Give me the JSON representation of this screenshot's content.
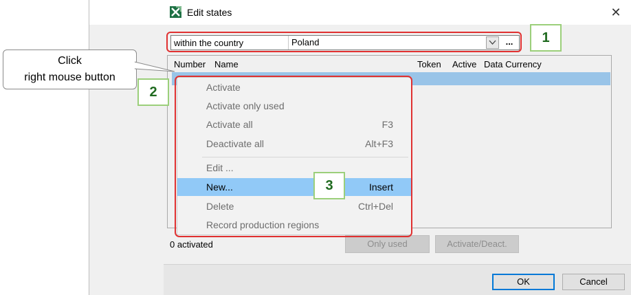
{
  "window": {
    "title": "Edit states",
    "close_glyph": "✕"
  },
  "filter": {
    "scope_label": "within the country",
    "country_value": "Poland",
    "ellipsis_label": "..."
  },
  "table": {
    "columns": [
      "Number",
      "Name",
      "Token",
      "Active",
      "Data Currency"
    ]
  },
  "context_menu": {
    "items": [
      {
        "label": "Activate",
        "shortcut": ""
      },
      {
        "label": "Activate only used",
        "shortcut": ""
      },
      {
        "label": "Activate all",
        "shortcut": "F3"
      },
      {
        "label": "Deactivate all",
        "shortcut": "Alt+F3"
      },
      {
        "label": "Edit ...",
        "shortcut": ""
      },
      {
        "label": "New...",
        "shortcut": "Insert"
      },
      {
        "label": "Delete",
        "shortcut": "Ctrl+Del"
      },
      {
        "label": "Record production regions",
        "shortcut": ""
      }
    ]
  },
  "footer": {
    "status": "0 activated",
    "only_used_label": "Only used",
    "activate_deact_label": "Activate/Deact.",
    "ok_label": "OK",
    "cancel_label": "Cancel"
  },
  "callout": {
    "line1": "Click",
    "line2": "right mouse button"
  },
  "badges": {
    "b1": "1",
    "b2": "2",
    "b3": "3"
  },
  "colors": {
    "highlight_red": "#e03030",
    "badge_green": "#9bcf7a",
    "menu_hover": "#91c9f7",
    "selected_row": "#99c4e8"
  },
  "icons": {
    "app": "excel-app-icon",
    "dropdown": "chevron-down-icon",
    "close": "close-icon"
  }
}
